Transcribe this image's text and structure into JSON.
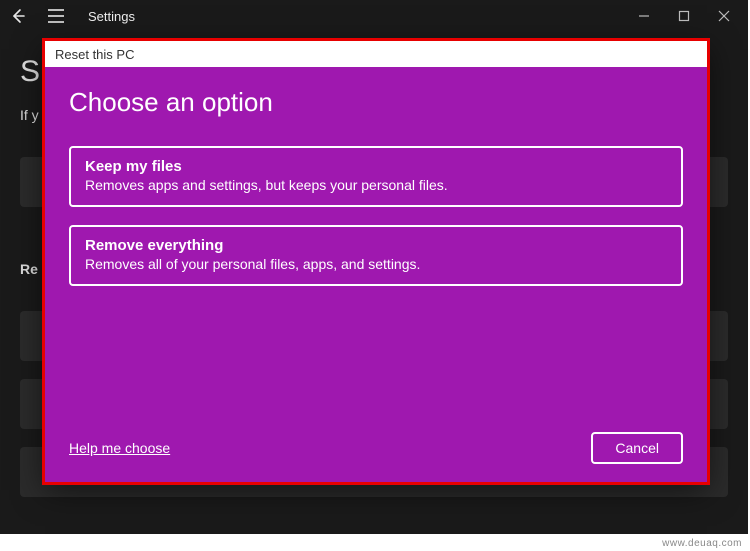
{
  "window": {
    "app_title": "Settings"
  },
  "background": {
    "big_letter": "S",
    "subline_prefix": "If y",
    "list_label_prefix": "Re"
  },
  "dialog": {
    "head": "Reset this PC",
    "title": "Choose an option",
    "options": [
      {
        "title": "Keep my files",
        "desc": "Removes apps and settings, but keeps your personal files."
      },
      {
        "title": "Remove everything",
        "desc": "Removes all of your personal files, apps, and settings."
      }
    ],
    "help_link": "Help me choose",
    "cancel": "Cancel"
  },
  "watermark": "www.deuaq.com"
}
